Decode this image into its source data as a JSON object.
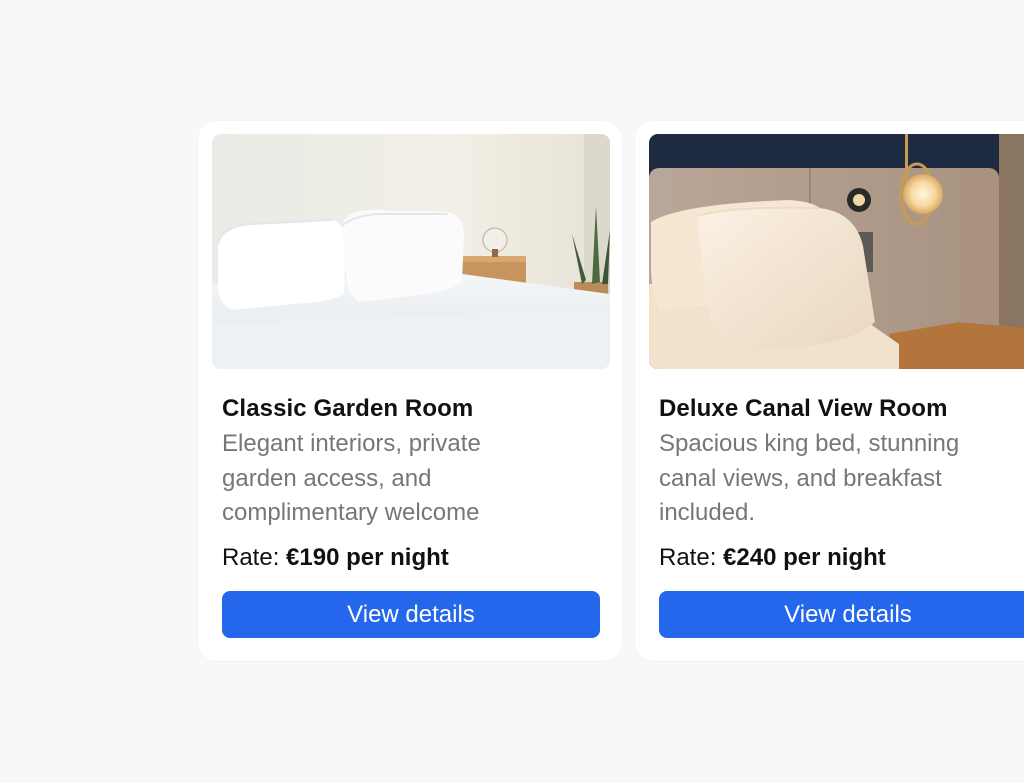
{
  "rooms": [
    {
      "title": "Classic Garden Room",
      "description": "Elegant interiors, private garden access, and complimentary welcome",
      "rate_label": "Rate:",
      "rate_value": "€190 per night",
      "button_label": "View details",
      "photo_icon": "bedroom-photo"
    },
    {
      "title": "Deluxe Canal View Room",
      "description": "Spacious king bed, stunning canal views, and breakfast included.",
      "rate_label": "Rate:",
      "rate_value": "€240 per night",
      "button_label": "View details",
      "photo_icon": "bedroom-photo"
    }
  ],
  "colors": {
    "accent": "#2467ec",
    "background": "#f8f7fa",
    "card": "#ffffff",
    "title_text": "#111114",
    "muted_text": "#76767b"
  }
}
